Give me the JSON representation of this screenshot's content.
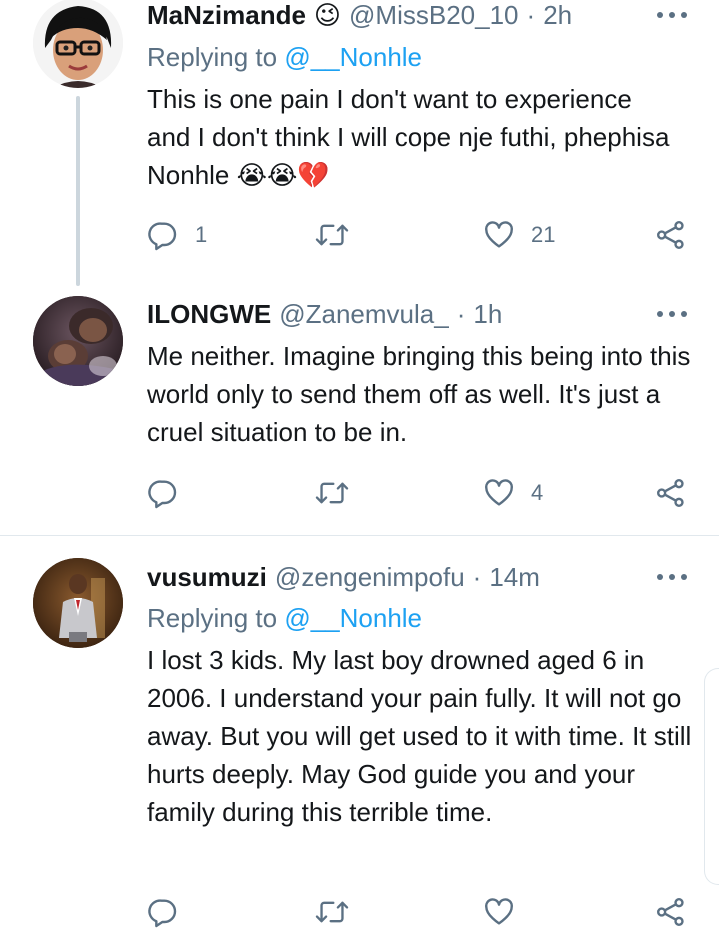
{
  "colors": {
    "text": "#14171a",
    "secondary": "#5b7083",
    "accent": "#1da1f2",
    "divider": "#e1e8ed"
  },
  "tweets": [
    {
      "name": "MaNzimande",
      "name_emoji": "😉",
      "handle": "@MissB20_10",
      "separator": "·",
      "time": "2h",
      "reply_prefix": "Replying to",
      "reply_mention": "@__Nonhle",
      "body": "This is one pain I don't want to experience and I don't think I will cope nje futhi, phephisa Nonhle 😭😭💔",
      "replies": "1",
      "retweets": "",
      "likes": "21",
      "avatar_icon": "bitmoji-glasses-avatar"
    },
    {
      "name": "ILONGWE",
      "handle": "@Zanemvula_",
      "separator": "·",
      "time": "1h",
      "body": "Me neither. Imagine bringing this being into this world only to send them off as well. It's just a cruel situation to be in.",
      "replies": "",
      "retweets": "",
      "likes": "4",
      "avatar_icon": "mother-child-photo-avatar"
    },
    {
      "name": "vusumuzi",
      "handle": "@zengenimpofu",
      "separator": "·",
      "time": "14m",
      "reply_prefix": "Replying to",
      "reply_mention": "@__Nonhle",
      "body": "I lost 3 kids. My last boy drowned aged 6 in 2006. I understand your pain fully. It will not go away. But you will get used to it with time. It still hurts deeply. May God guide you and your family during this terrible time.",
      "replies": "",
      "retweets": "",
      "likes": "",
      "avatar_icon": "man-in-suit-photo-avatar"
    }
  ],
  "icons": {
    "reply": "reply-icon",
    "retweet": "retweet-icon",
    "like": "heart-icon",
    "share": "share-icon",
    "more": "more-icon"
  }
}
